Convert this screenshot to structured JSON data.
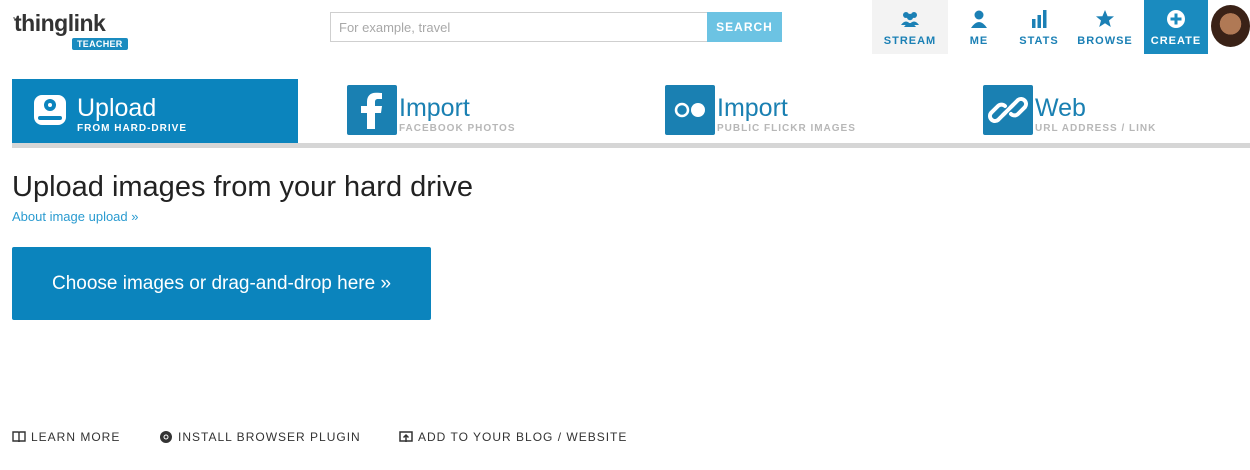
{
  "logo": {
    "text": "thinglink",
    "dots": "··",
    "badge": "TEACHER"
  },
  "search": {
    "placeholder": "For example, travel",
    "button_label": "SEARCH"
  },
  "nav": {
    "stream": {
      "label": "STREAM",
      "icon": "people-icon"
    },
    "me": {
      "label": "ME",
      "icon": "person-icon"
    },
    "stats": {
      "label": "STATS",
      "icon": "bar-chart-icon"
    },
    "browse": {
      "label": "BROWSE",
      "icon": "star-icon"
    },
    "create": {
      "label": "CREATE",
      "icon": "plus-circle-icon"
    }
  },
  "tabs": [
    {
      "title": "Upload",
      "subtitle": "FROM HARD-DRIVE",
      "icon": "hard-drive-icon",
      "active": true
    },
    {
      "title": "Import",
      "subtitle": "FACEBOOK PHOTOS",
      "icon": "facebook-icon",
      "active": false
    },
    {
      "title": "Import",
      "subtitle": "PUBLIC FLICKR IMAGES",
      "icon": "flickr-icon",
      "active": false
    },
    {
      "title": "Web",
      "subtitle": "URL ADDRESS / LINK",
      "icon": "link-icon",
      "active": false
    }
  ],
  "content": {
    "title": "Upload images from your hard drive",
    "about_link": "About image upload »",
    "choose_button": "Choose images or drag-and-drop here »"
  },
  "footer": {
    "learn_more": "LEARN MORE",
    "install_plugin": "INSTALL BROWSER PLUGIN",
    "add_to_blog": "ADD TO YOUR BLOG / WEBSITE"
  },
  "colors": {
    "accent": "#0b84bd",
    "nav_blue": "#1b80b5",
    "search_button": "#6cc3e3",
    "link": "#2a9bd0",
    "subtitle_gray": "#b7b7b7"
  }
}
